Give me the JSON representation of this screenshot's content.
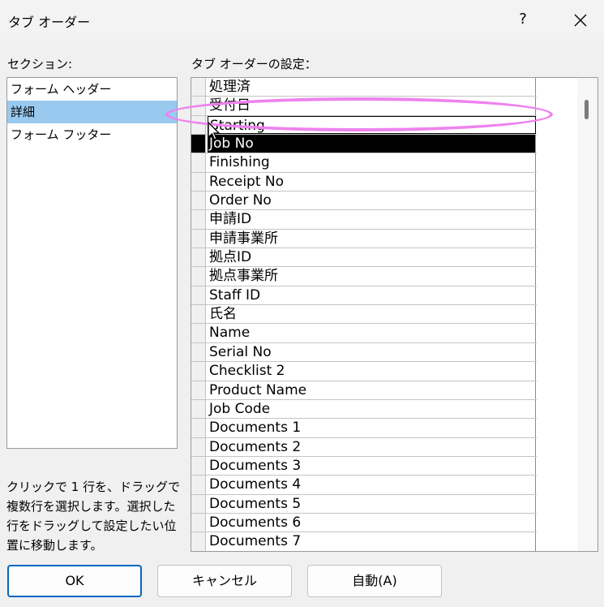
{
  "window": {
    "title": "タブ オーダー",
    "help": "?"
  },
  "sections": {
    "label": "セクション:",
    "items": [
      "フォーム ヘッダー",
      "詳細",
      "フォーム フッター"
    ],
    "selected_index": 1
  },
  "tab_order": {
    "label": "タブ オーダーの設定：",
    "rows": [
      "処理済",
      "受付日",
      "Starting",
      "Job No",
      "Finishing",
      "Receipt No",
      "Order No",
      "申請ID",
      "申請事業所",
      "拠点ID",
      "拠点事業所",
      "Staff ID",
      "氏名",
      "Name",
      "Serial No",
      "Checklist 2",
      "Product Name",
      "Job Code",
      "Documents 1",
      "Documents 2",
      "Documents 3",
      "Documents 4",
      "Documents 5",
      "Documents 6",
      "Documents 7"
    ],
    "highlighted_index": 3,
    "dragging_index": 2
  },
  "hint": "クリックで 1 行を、ドラッグで複数行を選択します。選択した行をドラッグして設定したい位置に移動します。",
  "buttons": {
    "ok": "OK",
    "cancel": "キャンセル",
    "auto": "自動(A)"
  },
  "colors": {
    "selection": "#99c9ef",
    "highlight": "#000000",
    "annotation": "#ee82ee",
    "default_button_border": "#0067c0"
  }
}
